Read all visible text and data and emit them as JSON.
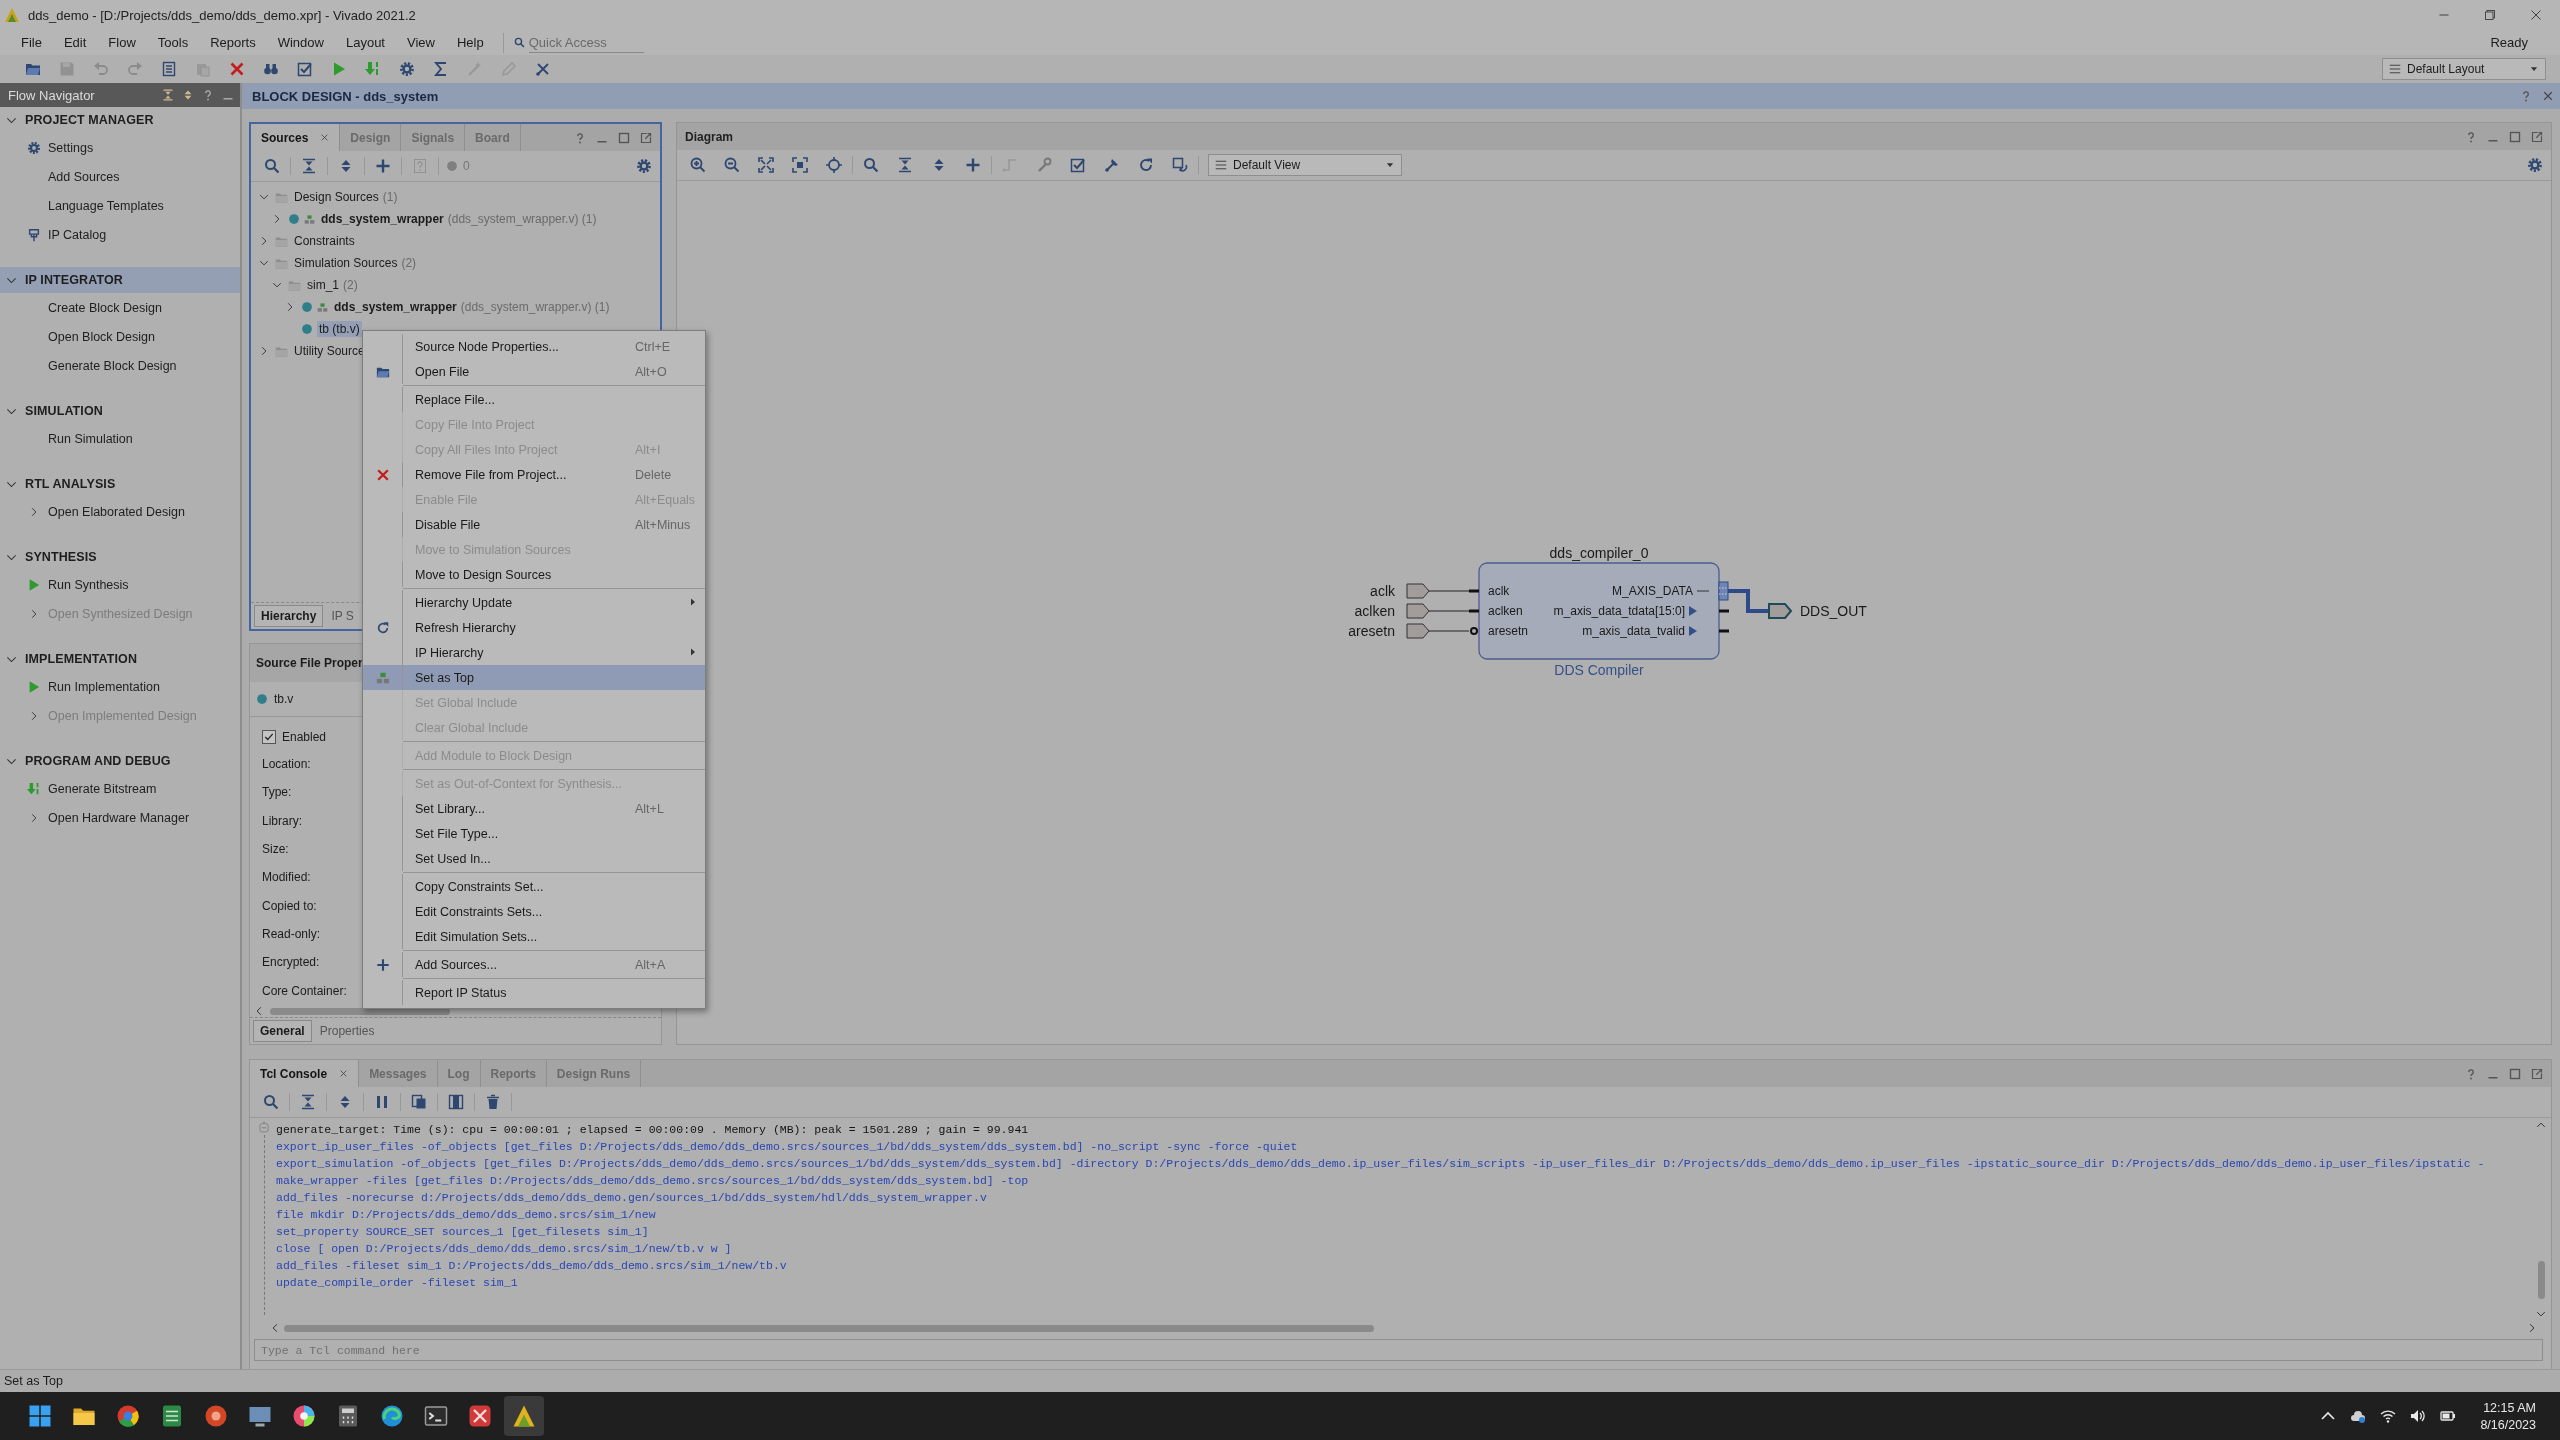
{
  "window": {
    "title": "dds_demo - [D:/Projects/dds_demo/dds_demo.xpr] - Vivado 2021.2"
  },
  "menu_bar": {
    "items": [
      "File",
      "Edit",
      "Flow",
      "Tools",
      "Reports",
      "Window",
      "Layout",
      "View",
      "Help"
    ],
    "quick_access": {
      "placeholder": "Quick Access"
    },
    "status": "Ready"
  },
  "toolbar": {
    "buttons": [
      {
        "kind": "open",
        "disabled": false
      },
      {
        "kind": "save",
        "disabled": true
      },
      {
        "kind": "undo",
        "disabled": true
      },
      {
        "kind": "redo",
        "disabled": true
      },
      {
        "kind": "report",
        "disabled": false
      },
      {
        "kind": "paste",
        "disabled": true
      },
      {
        "kind": "delete",
        "disabled": false
      },
      {
        "kind": "binoculars",
        "disabled": false
      },
      {
        "kind": "checklist",
        "disabled": false
      },
      {
        "kind": "run",
        "disabled": false
      },
      {
        "kind": "bitstream",
        "disabled": false
      },
      {
        "kind": "gear",
        "disabled": false
      },
      {
        "kind": "sigma",
        "disabled": false
      },
      {
        "kind": "wand",
        "disabled": true
      },
      {
        "kind": "tag",
        "disabled": true
      },
      {
        "kind": "probe",
        "disabled": false
      }
    ],
    "layout": "Default Layout"
  },
  "flow_navigator": {
    "title": "Flow Navigator",
    "sections": [
      {
        "title": "PROJECT MANAGER",
        "expanded": true,
        "selected": false,
        "items": [
          {
            "label": "Settings",
            "kind": "settings",
            "disabled": false
          },
          {
            "label": "Add Sources",
            "kind": "plain",
            "disabled": false
          },
          {
            "label": "Language Templates",
            "kind": "plain",
            "disabled": false
          },
          {
            "label": "IP Catalog",
            "kind": "catalog",
            "disabled": false
          }
        ]
      },
      {
        "title": "IP INTEGRATOR",
        "expanded": true,
        "selected": true,
        "items": [
          {
            "label": "Create Block Design",
            "kind": "plain",
            "disabled": false
          },
          {
            "label": "Open Block Design",
            "kind": "plain",
            "disabled": false
          },
          {
            "label": "Generate Block Design",
            "kind": "plain",
            "disabled": false
          }
        ]
      },
      {
        "title": "SIMULATION",
        "expanded": true,
        "selected": false,
        "items": [
          {
            "label": "Run Simulation",
            "kind": "plain",
            "disabled": false
          }
        ]
      },
      {
        "title": "RTL ANALYSIS",
        "expanded": true,
        "selected": false,
        "items": [
          {
            "label": "Open Elaborated Design",
            "kind": "expandable",
            "disabled": false
          }
        ]
      },
      {
        "title": "SYNTHESIS",
        "expanded": true,
        "selected": false,
        "items": [
          {
            "label": "Run Synthesis",
            "kind": "run",
            "disabled": false
          },
          {
            "label": "Open Synthesized Design",
            "kind": "expandable",
            "disabled": true
          }
        ]
      },
      {
        "title": "IMPLEMENTATION",
        "expanded": true,
        "selected": false,
        "items": [
          {
            "label": "Run Implementation",
            "kind": "run",
            "disabled": false
          },
          {
            "label": "Open Implemented Design",
            "kind": "expandable",
            "disabled": true
          }
        ]
      },
      {
        "title": "PROGRAM AND DEBUG",
        "expanded": true,
        "selected": false,
        "items": [
          {
            "label": "Generate Bitstream",
            "kind": "bitstream",
            "disabled": false
          },
          {
            "label": "Open Hardware Manager",
            "kind": "expandable",
            "disabled": false
          }
        ]
      }
    ]
  },
  "block_design": {
    "title": "BLOCK DESIGN - dds_system"
  },
  "sources_panel": {
    "tabs": [
      {
        "label": "Sources",
        "selected": true
      },
      {
        "label": "Design",
        "selected": false
      },
      {
        "label": "Signals",
        "selected": false
      },
      {
        "label": "Board",
        "selected": false
      }
    ],
    "toolbar": [
      {
        "kind": "search",
        "disabled": false
      },
      {
        "kind": "collapse",
        "disabled": false
      },
      {
        "kind": "expand",
        "disabled": false
      },
      {
        "kind": "plus",
        "disabled": false
      },
      {
        "kind": "help",
        "disabled": true
      }
    ],
    "count": "0",
    "tree": [
      {
        "label": "Design Sources",
        "detail": "(1)",
        "kind": "folder",
        "expanded": true,
        "selected": false,
        "children": [
          {
            "label": "dds_system_wrapper",
            "detail": "(dds_system_wrapper.v) (1)",
            "kind": "top",
            "expanded": false,
            "selected": false
          }
        ]
      },
      {
        "label": "Constraints",
        "kind": "folder",
        "expanded": false,
        "selected": false
      },
      {
        "label": "Simulation Sources",
        "detail": "(2)",
        "kind": "folder",
        "expanded": true,
        "selected": false,
        "children": [
          {
            "label": "sim_1",
            "detail": "(2)",
            "kind": "folder",
            "expanded": true,
            "selected": false,
            "children": [
              {
                "label": "dds_system_wrapper",
                "detail": "(dds_system_wrapper.v) (1)",
                "kind": "top",
                "expanded": false,
                "selected": false
              },
              {
                "label": "tb (tb.v)",
                "kind": "file",
                "selected": true
              }
            ]
          }
        ]
      },
      {
        "label": "Utility Source",
        "kind": "folder",
        "expanded": false,
        "selected": false
      }
    ],
    "bottom_tabs": [
      {
        "label": "Hierarchy",
        "selected": true
      },
      {
        "label": "IP S",
        "selected": false
      }
    ]
  },
  "properties_panel": {
    "title": "Source File Proper",
    "file": "tb.v",
    "enabled": {
      "label": "Enabled",
      "checked": true
    },
    "fields": [
      "Location:",
      "Type:",
      "Library:",
      "Size:",
      "Modified:",
      "Copied to:",
      "Read-only:",
      "Encrypted:",
      "Core Container:"
    ],
    "tabs": [
      {
        "label": "General",
        "selected": true
      },
      {
        "label": "Properties",
        "selected": false
      }
    ]
  },
  "diagram": {
    "title": "Diagram",
    "toolbar": [
      {
        "kind": "zoom_in",
        "disabled": false
      },
      {
        "kind": "zoom_out",
        "disabled": false
      },
      {
        "kind": "fit",
        "disabled": false
      },
      {
        "kind": "fit_selection",
        "disabled": false
      },
      {
        "kind": "target",
        "disabled": false
      },
      {
        "kind": "search",
        "disabled": false
      },
      {
        "kind": "collapse",
        "disabled": false
      },
      {
        "kind": "expand",
        "disabled": false
      },
      {
        "kind": "plus",
        "disabled": false
      },
      {
        "kind": "route",
        "disabled": true
      },
      {
        "kind": "wrench",
        "disabled": false
      },
      {
        "kind": "checklist",
        "disabled": false
      },
      {
        "kind": "autoconnect",
        "disabled": false
      },
      {
        "kind": "refresh",
        "disabled": false
      },
      {
        "kind": "regenerate",
        "disabled": false
      }
    ],
    "view": "Default View",
    "block": {
      "name": "dds_compiler_0",
      "type": "DDS Compiler",
      "inputs": [
        {
          "name": "aclk",
          "kind": "signal"
        },
        {
          "name": "aclken",
          "kind": "signal"
        },
        {
          "name": "aresetn",
          "kind": "inverted"
        }
      ],
      "outputs": [
        {
          "name": "M_AXIS_DATA",
          "kind": "interface"
        },
        {
          "name": "m_axis_data_tdata[15:0]",
          "kind": "signal"
        },
        {
          "name": "m_axis_data_tvalid",
          "kind": "signal"
        }
      ]
    },
    "input_ports": [
      "aclk",
      "aclken",
      "aresetn"
    ],
    "output_port": "DDS_OUT"
  },
  "tcl_console": {
    "tabs": [
      {
        "label": "Tcl Console",
        "selected": true
      },
      {
        "label": "Messages",
        "selected": false
      },
      {
        "label": "Log",
        "selected": false
      },
      {
        "label": "Reports",
        "selected": false
      },
      {
        "label": "Design Runs",
        "selected": false
      }
    ],
    "toolbar": [
      {
        "kind": "search",
        "disabled": false
      },
      {
        "kind": "collapse",
        "disabled": false
      },
      {
        "kind": "expand",
        "disabled": false
      },
      {
        "kind": "pause",
        "disabled": false
      },
      {
        "kind": "copy",
        "disabled": false
      },
      {
        "kind": "columns",
        "disabled": false
      },
      {
        "kind": "trash",
        "disabled": false
      }
    ],
    "lines": [
      {
        "kind": "output",
        "text": "generate_target: Time (s): cpu = 00:00:01 ; elapsed = 00:00:09 . Memory (MB): peak = 1501.289 ; gain = 99.941"
      },
      {
        "kind": "command",
        "text": "export_ip_user_files -of_objects [get_files D:/Projects/dds_demo/dds_demo.srcs/sources_1/bd/dds_system/dds_system.bd] -no_script -sync -force -quiet"
      },
      {
        "kind": "command",
        "text": "export_simulation -of_objects [get_files D:/Projects/dds_demo/dds_demo.srcs/sources_1/bd/dds_system/dds_system.bd] -directory D:/Projects/dds_demo/dds_demo.ip_user_files/sim_scripts -ip_user_files_dir D:/Projects/dds_demo/dds_demo.ip_user_files -ipstatic_source_dir D:/Projects/dds_demo/dds_demo.ip_user_files/ipstatic -"
      },
      {
        "kind": "command",
        "text": "make_wrapper -files [get_files D:/Projects/dds_demo/dds_demo.srcs/sources_1/bd/dds_system/dds_system.bd] -top"
      },
      {
        "kind": "command",
        "text": "add_files -norecurse d:/Projects/dds_demo/dds_demo.gen/sources_1/bd/dds_system/hdl/dds_system_wrapper.v"
      },
      {
        "kind": "command",
        "text": "file mkdir D:/Projects/dds_demo/dds_demo.srcs/sim_1/new"
      },
      {
        "kind": "command",
        "text": "set_property SOURCE_SET sources_1 [get_filesets sim_1]"
      },
      {
        "kind": "command",
        "text": "close [ open D:/Projects/dds_demo/dds_demo.srcs/sim_1/new/tb.v w ]"
      },
      {
        "kind": "command",
        "text": "add_files -fileset sim_1 D:/Projects/dds_demo/dds_demo.srcs/sim_1/new/tb.v"
      },
      {
        "kind": "command",
        "text": "update_compile_order -fileset sim_1"
      }
    ],
    "placeholder": "Type a Tcl command here"
  },
  "context_menu": {
    "sections": [
      [
        {
          "label": "Source Node Properties...",
          "shortcut": "Ctrl+E",
          "disabled": false,
          "selected": false
        },
        {
          "label": "Open File",
          "shortcut": "Alt+O",
          "kind": "open",
          "disabled": false,
          "selected": false
        }
      ],
      [
        {
          "label": "Replace File...",
          "disabled": false,
          "selected": false
        },
        {
          "label": "Copy File Into Project",
          "disabled": true,
          "selected": false
        },
        {
          "label": "Copy All Files Into Project",
          "shortcut": "Alt+I",
          "disabled": true,
          "selected": false
        },
        {
          "label": "Remove File from Project...",
          "shortcut": "Delete",
          "kind": "remove",
          "disabled": false,
          "selected": false
        },
        {
          "label": "Enable File",
          "shortcut": "Alt+Equals",
          "disabled": true,
          "selected": false
        },
        {
          "label": "Disable File",
          "shortcut": "Alt+Minus",
          "disabled": false,
          "selected": false
        },
        {
          "label": "Move to Simulation Sources",
          "disabled": true,
          "selected": false
        },
        {
          "label": "Move to Design Sources",
          "disabled": false,
          "selected": false
        }
      ],
      [
        {
          "label": "Hierarchy Update",
          "submenu": true,
          "disabled": false,
          "selected": false
        },
        {
          "label": "Refresh Hierarchy",
          "kind": "refresh",
          "disabled": false,
          "selected": false
        },
        {
          "label": "IP Hierarchy",
          "submenu": true,
          "disabled": false,
          "selected": false
        },
        {
          "label": "Set as Top",
          "kind": "top",
          "disabled": false,
          "selected": true
        },
        {
          "label": "Set Global Include",
          "disabled": true,
          "selected": false
        },
        {
          "label": "Clear Global Include",
          "disabled": true,
          "selected": false
        }
      ],
      [
        {
          "label": "Add Module to Block Design",
          "disabled": true,
          "selected": false
        }
      ],
      [
        {
          "label": "Set as Out-of-Context for Synthesis...",
          "disabled": true,
          "selected": false
        },
        {
          "label": "Set Library...",
          "shortcut": "Alt+L",
          "disabled": false,
          "selected": false
        },
        {
          "label": "Set File Type...",
          "disabled": false,
          "selected": false
        },
        {
          "label": "Set Used In...",
          "disabled": false,
          "selected": false
        }
      ],
      [
        {
          "label": "Copy Constraints Set...",
          "disabled": false,
          "selected": false
        },
        {
          "label": "Edit Constraints Sets...",
          "disabled": false,
          "selected": false
        },
        {
          "label": "Edit Simulation Sets...",
          "disabled": false,
          "selected": false
        }
      ],
      [
        {
          "label": "Add Sources...",
          "shortcut": "Alt+A",
          "kind": "add",
          "disabled": false,
          "selected": false
        }
      ],
      [
        {
          "label": "Report IP Status",
          "disabled": false,
          "selected": false
        }
      ]
    ]
  },
  "status_bar": "Set as Top",
  "taskbar": {
    "apps": [
      {
        "kind": "start",
        "selected": false
      },
      {
        "kind": "folder",
        "selected": false
      },
      {
        "kind": "browser",
        "selected": false
      },
      {
        "kind": "sheet",
        "selected": false
      },
      {
        "kind": "slides",
        "selected": false
      },
      {
        "kind": "monitor",
        "selected": false
      },
      {
        "kind": "wheel",
        "selected": false
      },
      {
        "kind": "calculator",
        "selected": false
      },
      {
        "kind": "swirl",
        "selected": false
      },
      {
        "kind": "terminal",
        "selected": false
      },
      {
        "kind": "redapp",
        "selected": false
      },
      {
        "kind": "logo",
        "selected": true
      }
    ],
    "time": "12:15 AM",
    "date": "8/16/2023"
  }
}
